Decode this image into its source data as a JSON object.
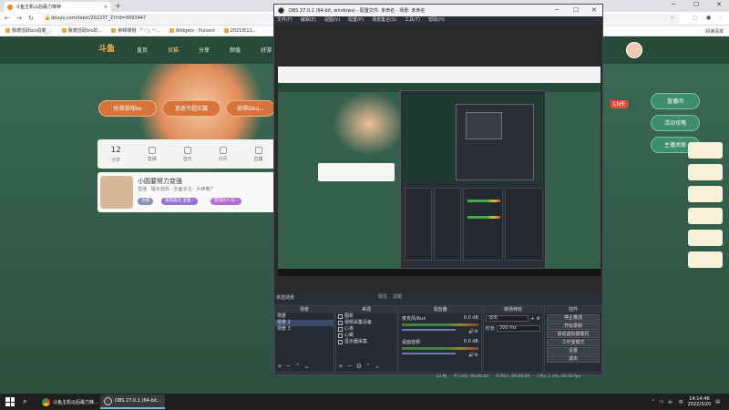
{
  "browser": {
    "tab_title": "斗鱼主机以后最力锋钟",
    "url": "douyu.com/topic/20225T_Z?rid=9993447",
    "bookmarks": [
      "致德活跃bio说着_...",
      "致德活跃bio的...",
      "钟辉哪侧 「ᵔ-ᵔ」ᵕᵒ...",
      "Widgets - Pulsoid",
      "2021年11..."
    ],
    "bookmarks_right": "阅读清单"
  },
  "site": {
    "logo": "斗鱼",
    "nav": [
      "直页",
      "贡猫",
      "分享",
      "颜值",
      "好游"
    ],
    "pill_buttons": [
      "抢滑游戏bo",
      "追逐不超实篇",
      "获得Dou..."
    ],
    "stats": [
      {
        "num": "12",
        "label": "分享"
      },
      {
        "num": "",
        "label": "直播"
      },
      {
        "num": "",
        "label": "音乐"
      },
      {
        "num": "",
        "label": "日历"
      },
      {
        "num": "",
        "label": "直播"
      }
    ],
    "streamer_name": "小圆要努力变强",
    "streamer_meta": "直播 · 擅长游戏 · 全面关注 · 大神推广",
    "tags": [
      "注册",
      "暖萌晨光 主播 ›",
      "游戏达人号 ›"
    ],
    "side_buttons": [
      "直播间",
      "活动攻略",
      "主播关联"
    ],
    "live_badge": "LIVE"
  },
  "obs": {
    "title": "OBS 27.0.1 (64-bit, windows) - 配置文件: 未命名 - 场景: 未命名",
    "menu": [
      "文件(F)",
      "编辑(E)",
      "视图(V)",
      "配置(P)",
      "场景集合(S)",
      "工具(T)",
      "帮助(H)"
    ],
    "selected_label": "未选场景",
    "top_tabs": [
      "属性",
      "滤镜"
    ],
    "scenes_title": "场景",
    "scenes": [
      "场景",
      "场景 2",
      "场景 3"
    ],
    "sources_title": "来源",
    "sources": [
      "图象",
      "视频采集设备",
      "心率",
      "心跳",
      "显示器采集"
    ],
    "mixer_title": "混音器",
    "mixer": [
      {
        "name": "麦克风/Aux",
        "db": "0.0 dB"
      },
      {
        "name": "桌面音频",
        "db": "0.0 dB"
      }
    ],
    "transitions_title": "转场特效",
    "transition_value": "淡出",
    "duration_label": "时长",
    "duration_value": "300 ms",
    "controls_title": "控件",
    "controls": [
      "停止推流",
      "开始录制",
      "启动虚拟摄像机",
      "工作室模式",
      "设置",
      "退出"
    ],
    "status": {
      "live": "LIVE: 00:00:00",
      "rec": "REC: 00:00:00",
      "cpu": "CPU: 1.3%, 60.00 fps",
      "dropped": "12 帧"
    }
  },
  "taskbar": {
    "apps": [
      "斗鱼主机以后最力锋...",
      "OBS 27.0.1 (64-bit..."
    ],
    "time": "14:14:46",
    "date": "2022/3/20",
    "lang": "中"
  }
}
